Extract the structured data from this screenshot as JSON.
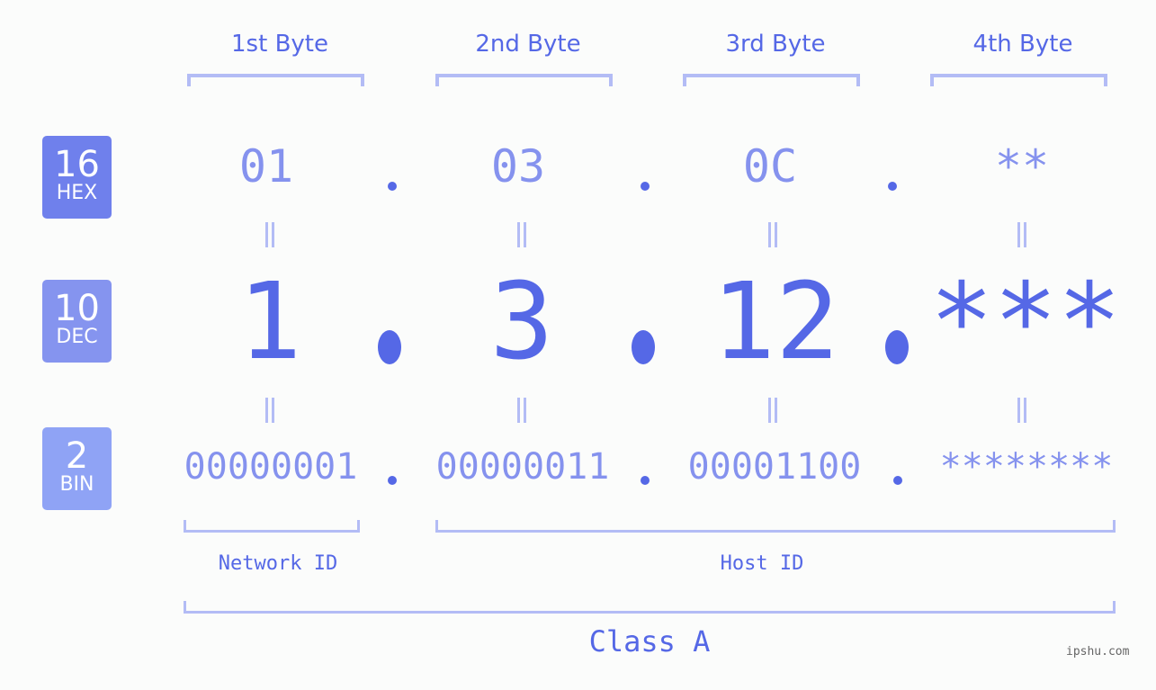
{
  "bases": [
    {
      "num": "16",
      "label": "HEX",
      "color": "#6f80ec"
    },
    {
      "num": "10",
      "label": "DEC",
      "color": "#8594ef"
    },
    {
      "num": "2",
      "label": "BIN",
      "color": "#8fa3f5"
    }
  ],
  "byte_headers": [
    "1st Byte",
    "2nd Byte",
    "3rd Byte",
    "4th Byte"
  ],
  "hex": [
    "01",
    "03",
    "0C",
    "**"
  ],
  "dec": [
    "1",
    "3",
    "12",
    "***"
  ],
  "bin": [
    "00000001",
    "00000011",
    "00001100",
    "********"
  ],
  "network_label": "Network ID",
  "host_label": "Host ID",
  "class_label": "Class A",
  "watermark": "ipshu.com",
  "colors": {
    "primary": "#5568e6",
    "light": "#8592ee",
    "bracket": "#b3bcf5"
  }
}
